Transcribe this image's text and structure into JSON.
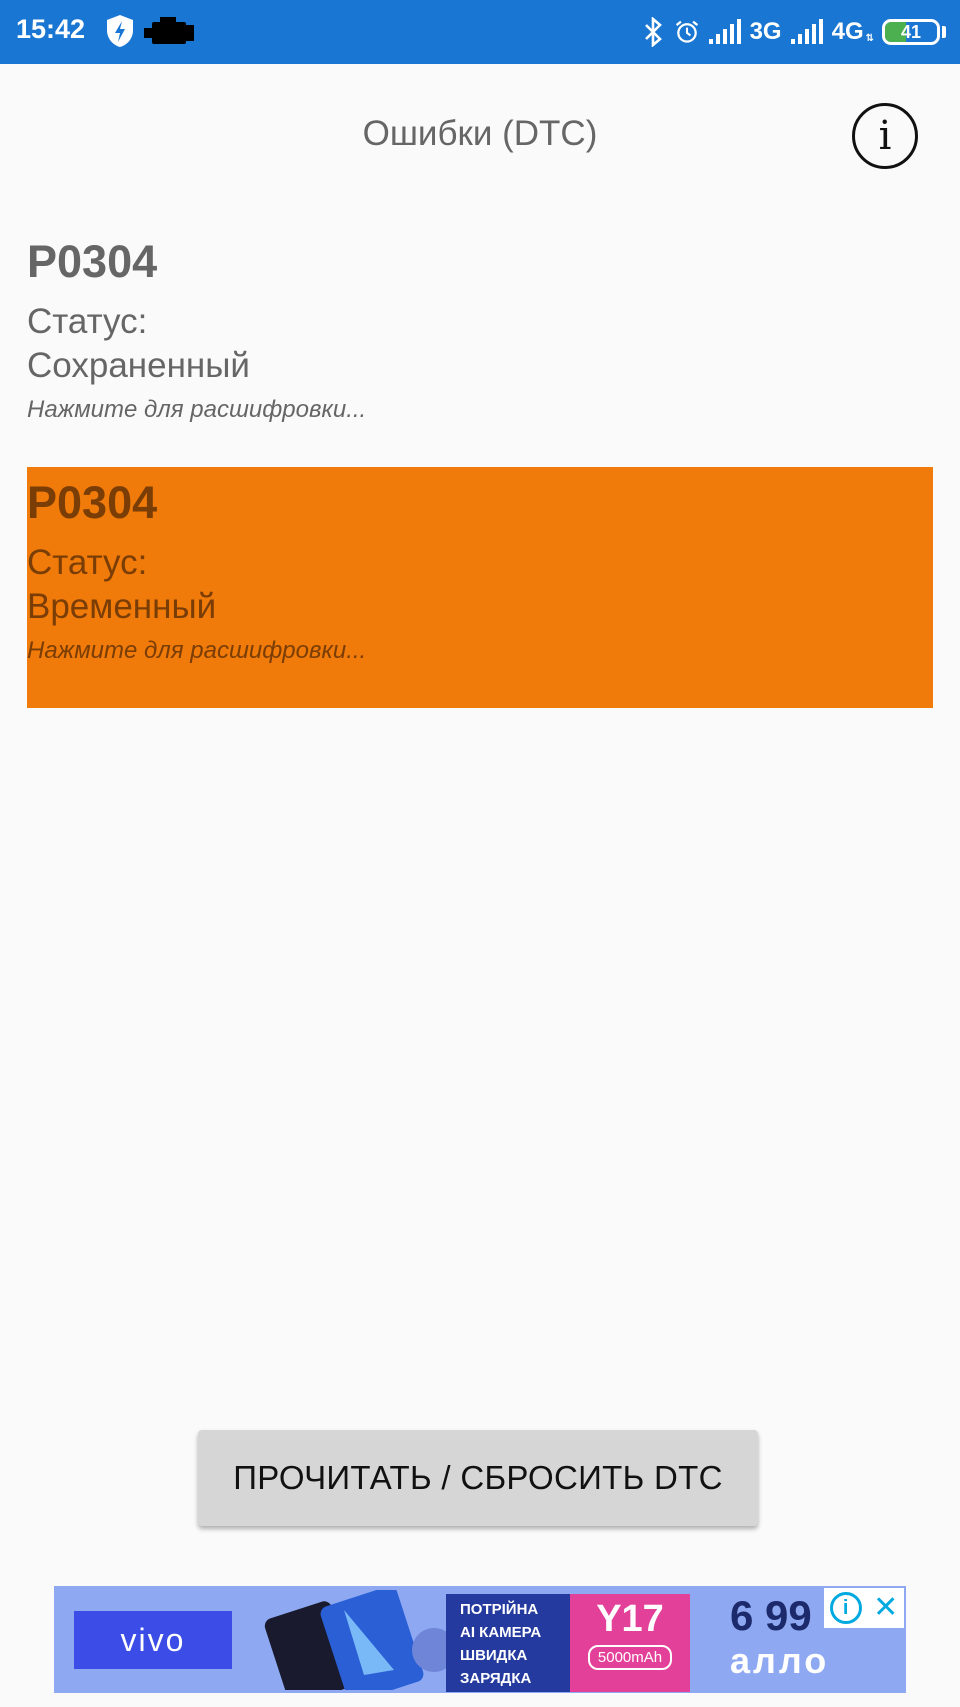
{
  "status_bar": {
    "time": "15:42",
    "network_1": "3G",
    "network_2": "4G",
    "battery_percent": 41,
    "battery_text": "41"
  },
  "header": {
    "title": "Ошибки (DTC)",
    "info_glyph": "i"
  },
  "dtc_items": [
    {
      "code": "P0304",
      "status_label": "Статус:",
      "status": "Сохраненный",
      "hint": "Нажмите для расшифровки..."
    },
    {
      "code": "P0304",
      "status_label": "Статус:",
      "status": "Временный",
      "hint": "Нажмите для расшифровки..."
    }
  ],
  "actions": {
    "read_reset_label": "ПРОЧИТАТЬ / СБРОСИТЬ DTC"
  },
  "ad": {
    "brand_left": "vivo",
    "promo_lines": [
      "ПОТРІЙНА",
      "AI КАМЕРА",
      "ШВИДКА",
      "ЗАРЯДКА"
    ],
    "model": "Y17",
    "battery": "5000mAh",
    "price": "6 99",
    "store": "алло"
  },
  "colors": {
    "status_bar": "#1976d2",
    "highlight": "#f07a0a",
    "button": "#d6d6d6"
  },
  "icons": [
    "shield-bolt-icon",
    "check-engine-icon",
    "bluetooth-icon",
    "alarm-icon",
    "signal-icon",
    "battery-icon",
    "info-icon",
    "ad-info-icon",
    "ad-close-icon"
  ]
}
